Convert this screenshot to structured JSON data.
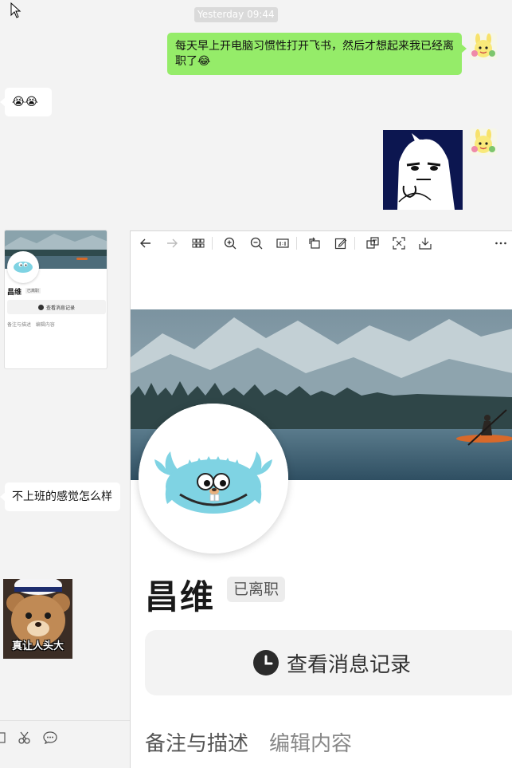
{
  "chat": {
    "timestamp": "Yesterday 09:44",
    "messages": {
      "outgoing_text": "每天早上开电脑习惯性打开飞书，然后才想起来我已经离职了",
      "incoming_emoji": "😭😭",
      "incoming_question": "不上班的感觉怎么样"
    },
    "sticker_bear_caption": "真让人头大"
  },
  "thumbnail": {
    "name": "昌维",
    "tag": "已离职",
    "button": "查看消息记录",
    "tab1": "备注与描述",
    "tab2": "编辑内容"
  },
  "viewer": {
    "toolbar_icons": [
      "back-icon",
      "forward-icon",
      "grid-icon",
      "zoom-in-icon",
      "zoom-out-icon",
      "actual-size-icon",
      "rotate-icon",
      "edit-icon",
      "extract-text-icon",
      "scan-icon",
      "download-icon",
      "more-icon"
    ],
    "profile": {
      "name": "昌维",
      "status_tag": "已离职",
      "history_button": "查看消息记录",
      "tabs": [
        "备注与描述",
        "编辑内容"
      ]
    }
  },
  "colors": {
    "outgoing_bubble": "#95ec69",
    "chat_background": "#f3f3f3",
    "gopher": "#7fd3e3"
  }
}
